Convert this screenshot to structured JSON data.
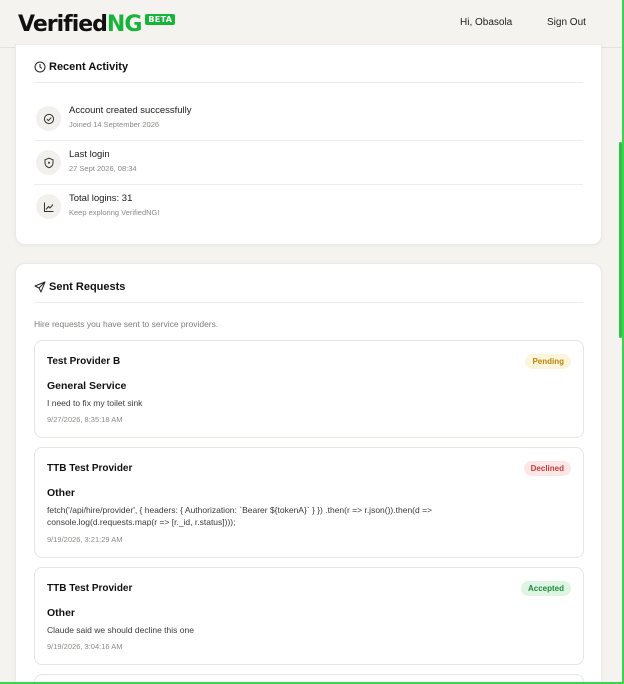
{
  "header": {
    "logo_main": "Verified",
    "logo_accent": "NG",
    "beta": "BETA",
    "greeting": "Hi, Obasola",
    "signout": "Sign Out"
  },
  "activity": {
    "title": "Recent Activity",
    "items": [
      {
        "icon": "check-circle-icon",
        "main": "Account created successfully",
        "sub": "Joined 14 September 2026"
      },
      {
        "icon": "shield-icon",
        "main": "Last login",
        "sub": "27 Sept 2026, 08:34"
      },
      {
        "icon": "chart-line-icon",
        "main": "Total logins: 31",
        "sub": "Keep exploring VerifiedNG!"
      }
    ]
  },
  "requests": {
    "title": "Sent Requests",
    "subtitle": "Hire requests you have sent to service providers.",
    "items": [
      {
        "provider": "Test Provider B",
        "status": "Pending",
        "category": "General Service",
        "message": "I need to fix my toilet sink",
        "time": "9/27/2026, 8:35:18 AM"
      },
      {
        "provider": "TTB Test Provider",
        "status": "Declined",
        "category": "Other",
        "message": "fetch('/api/hire/provider', { headers: { Authorization: `Bearer ${tokenA}` } }) .then(r => r.json()).then(d => console.log(d.requests.map(r => [r._id, r.status])));",
        "time": "9/19/2026, 3:21:29 AM"
      },
      {
        "provider": "TTB Test Provider",
        "status": "Accepted",
        "category": "Other",
        "message": "Claude said we should decline this one",
        "time": "9/19/2026, 3:04:16 AM"
      }
    ]
  },
  "colors": {
    "brand": "#16b53a",
    "pending": "#b8860b",
    "declined": "#c43c3c",
    "accepted": "#1e8a3a"
  }
}
